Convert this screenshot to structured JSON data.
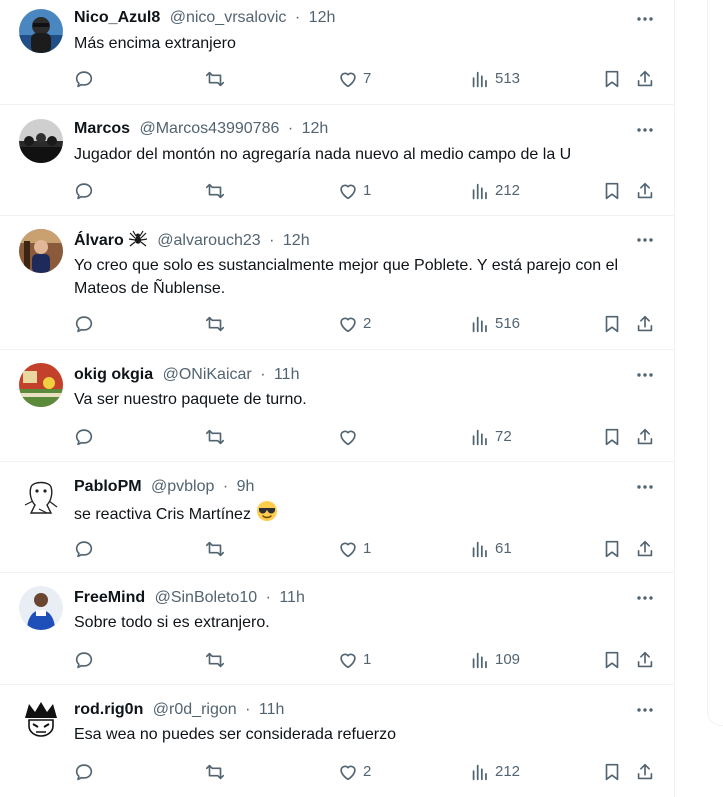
{
  "tweets": [
    {
      "name": "Nico_Azul8",
      "handle": "@nico_vrsalovic",
      "time": "12h",
      "text": "Más encima extranjero",
      "replies": "",
      "retweets": "",
      "likes": "7",
      "views": "513"
    },
    {
      "name": "Marcos",
      "handle": "@Marcos43990786",
      "time": "12h",
      "text": "Jugador del montón no agregaría nada nuevo al medio campo de la U",
      "replies": "",
      "retweets": "",
      "likes": "1",
      "views": "212"
    },
    {
      "name": "Álvaro",
      "name_emoji": "spider-icon",
      "handle": "@alvarouch23",
      "time": "12h",
      "text": "Yo creo que solo es sustancialmente mejor que Poblete. Y está parejo con el Mateos de Ñublense.",
      "replies": "",
      "retweets": "",
      "likes": "2",
      "views": "516"
    },
    {
      "name": "okig okgia",
      "handle": "@ONiKaicar",
      "time": "11h",
      "text": "Va ser nuestro paquete de turno.",
      "replies": "",
      "retweets": "",
      "likes": "",
      "views": "72"
    },
    {
      "name": "PabloPM",
      "handle": "@pvblop",
      "time": "9h",
      "text": "se reactiva Cris Martínez",
      "text_emoji": "sunglasses-emoji",
      "replies": "",
      "retweets": "",
      "likes": "1",
      "views": "61"
    },
    {
      "name": "FreeMind",
      "handle": "@SinBoleto10",
      "time": "11h",
      "text": "Sobre todo si es extranjero.",
      "replies": "",
      "retweets": "",
      "likes": "1",
      "views": "109"
    },
    {
      "name": "rod.rig0n",
      "handle": "@r0d_rigon",
      "time": "11h",
      "text": "Esa wea no puedes ser considerada refuerzo",
      "replies": "",
      "retweets": "",
      "likes": "2",
      "views": "212"
    }
  ],
  "separator": "·",
  "icons": {
    "more": "more-dots-icon",
    "reply": "reply-icon",
    "retweet": "retweet-icon",
    "like": "heart-icon",
    "views": "views-chart-icon",
    "bookmark": "bookmark-icon",
    "share": "share-icon"
  },
  "colors": {
    "text": "#0f1419",
    "secondary": "#536471",
    "border": "#eff3f4",
    "background": "#ffffff"
  }
}
